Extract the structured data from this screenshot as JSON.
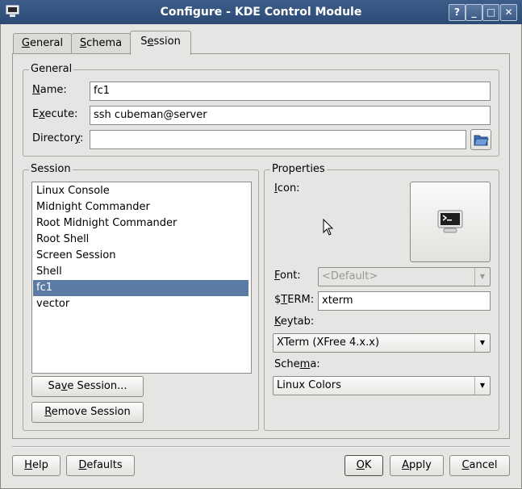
{
  "window": {
    "title": "Configure - KDE Control Module",
    "help_btn": "?",
    "minimize_btn": "_",
    "maximize_btn": "□",
    "close_btn": "✕"
  },
  "tabs": [
    {
      "pre": "",
      "key": "G",
      "post": "eneral"
    },
    {
      "pre": "",
      "key": "S",
      "post": "chema"
    },
    {
      "pre": "S",
      "key": "e",
      "post": "ssion"
    }
  ],
  "general": {
    "legend": "General",
    "name_label": {
      "pre": "",
      "key": "N",
      "post": "ame:"
    },
    "name_value": "fc1",
    "execute_label": {
      "pre": "E",
      "key": "x",
      "post": "ecute:"
    },
    "execute_value": "ssh cubeman@server",
    "directory_label": {
      "pre": "Director",
      "key": "y",
      "post": ":"
    },
    "directory_value": ""
  },
  "session": {
    "legend": "Session",
    "items": [
      "Linux Console",
      "Midnight Commander",
      "Root Midnight Commander",
      "Root Shell",
      "Screen Session",
      "Shell",
      "fc1",
      "vector"
    ],
    "selected_index": 6,
    "save_label": {
      "pre": "Sa",
      "key": "v",
      "post": "e Session..."
    },
    "remove_label": {
      "pre": "",
      "key": "R",
      "post": "emove Session"
    }
  },
  "properties": {
    "legend": "Properties",
    "icon_label": {
      "pre": "",
      "key": "I",
      "post": "con:"
    },
    "font_label": {
      "pre": "",
      "key": "F",
      "post": "ont:"
    },
    "font_value": "<Default>",
    "term_label": {
      "pre": "$",
      "key": "T",
      "post": "ERM:"
    },
    "term_value": "xterm",
    "keytab_label": {
      "pre": "",
      "key": "K",
      "post": "eytab:"
    },
    "keytab_value": "XTerm (XFree 4.x.x)",
    "schema_label": {
      "pre": "Sche",
      "key": "m",
      "post": "a:"
    },
    "schema_value": "Linux Colors"
  },
  "footer": {
    "help": {
      "pre": "",
      "key": "H",
      "post": "elp"
    },
    "defaults": {
      "pre": "",
      "key": "D",
      "post": "efaults"
    },
    "ok": {
      "pre": "",
      "key": "O",
      "post": "K"
    },
    "apply": {
      "pre": "",
      "key": "A",
      "post": "pply"
    },
    "cancel": {
      "pre": "",
      "key": "C",
      "post": "ancel"
    }
  },
  "colors": {
    "titlebar": "#2c4a75",
    "selection": "#5b7aa4",
    "window_bg": "#e6e5e3"
  }
}
